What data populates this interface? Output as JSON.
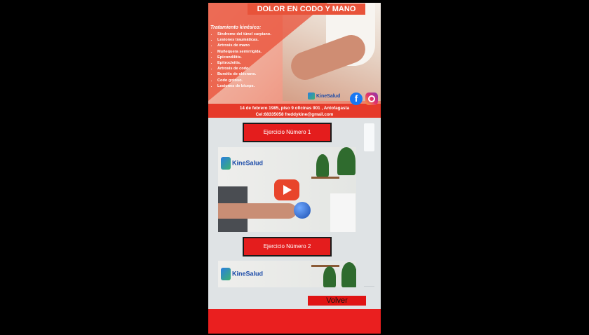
{
  "banner": {
    "title": "DOLOR EN CODO Y MANO",
    "treatment_title": "Tratamiento kinésico:",
    "treatments": [
      "Síndrome del túnel carpiano.",
      "Lesiones traumáticas.",
      "Artrosis de mano",
      "Muñequera semirrígida.",
      "Epicondilitis.",
      "Epitrocleitis.",
      "Artrosis de codo.",
      "Bursitis de olécrano.",
      "Codo gotoso.",
      "Lesiones de bíceps."
    ],
    "brand": "KineSalud",
    "address": "14 de febrero 1985, piso 9 oficinas 901 , Antofagasta",
    "contact": "Cel:68335058 freddykine@gmail.com"
  },
  "exercises": [
    {
      "label": "Ejercicio Número 1",
      "video_brand": "KineSalud"
    },
    {
      "label": "Ejercicio Número 2",
      "video_brand": "KineSalud"
    }
  ],
  "back_button": "Volver",
  "colors": {
    "accent": "#e41d1d",
    "background": "#000000",
    "panel": "#dfe3e5"
  }
}
